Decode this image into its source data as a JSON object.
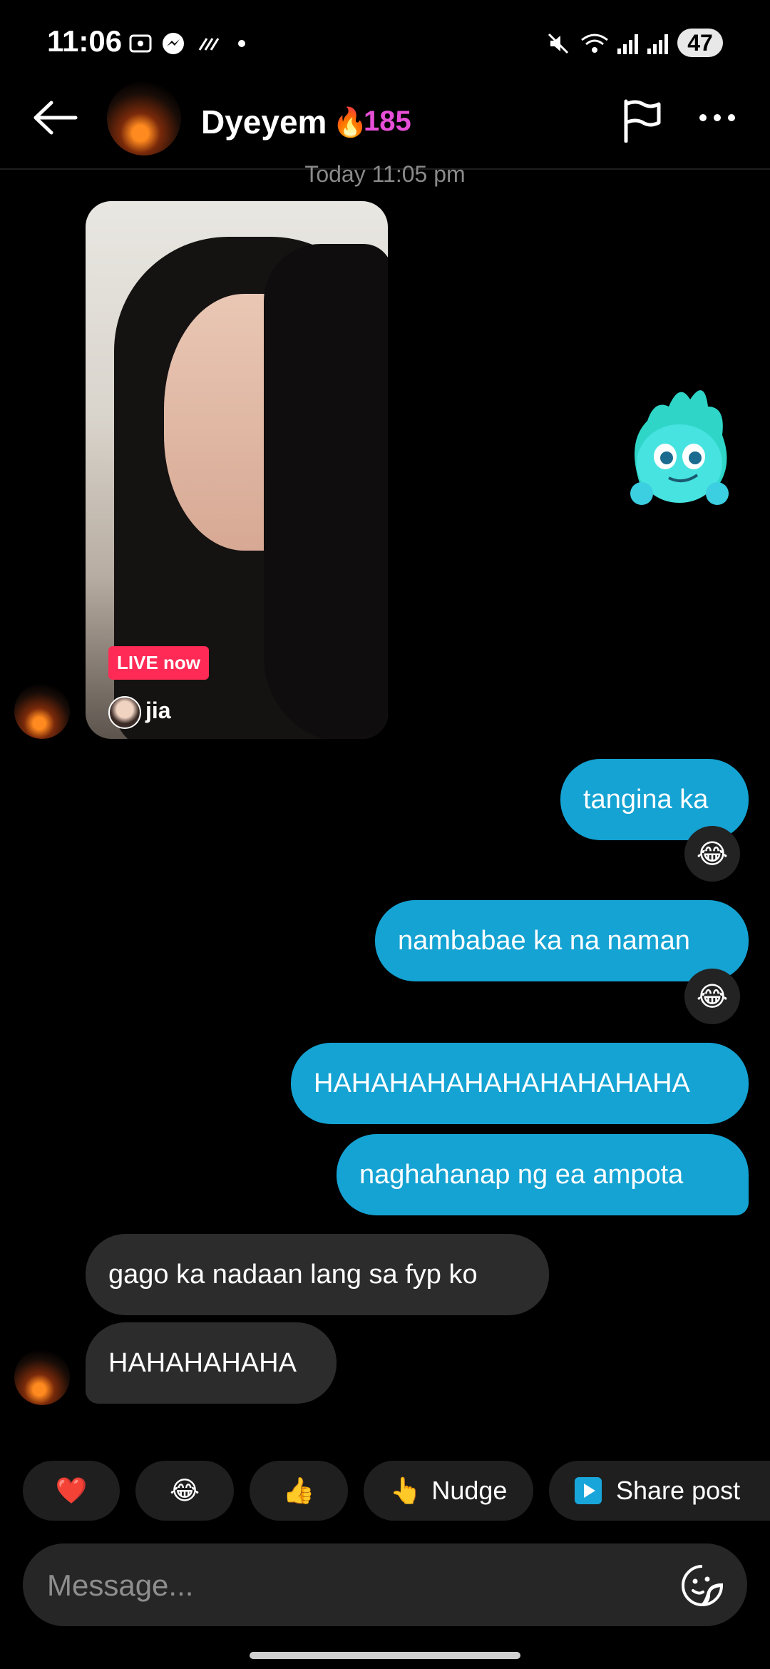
{
  "status_bar": {
    "time": "11:06",
    "battery": "47"
  },
  "header": {
    "name": "Dyeyem",
    "flame": "🔥",
    "streak": "185"
  },
  "chat": {
    "date_label": "Today 11:05 pm",
    "live_card": {
      "badge": "LIVE now",
      "username": "jia"
    },
    "messages": [
      {
        "text": "tangina ka",
        "direction": "outgoing",
        "reaction": "😂"
      },
      {
        "text": "nambabae ka na naman",
        "direction": "outgoing",
        "reaction": "😂"
      },
      {
        "text": "HAHAHAHAHAHAHAHAHAHA",
        "direction": "outgoing"
      },
      {
        "text": "naghahanap ng ea ampota",
        "direction": "outgoing"
      },
      {
        "text": "gago ka nadaan lang sa fyp ko",
        "direction": "incoming"
      },
      {
        "text": "HAHAHAHAHA",
        "direction": "incoming"
      }
    ]
  },
  "quick_replies": {
    "heart": "❤️",
    "laugh": "😂",
    "thumbs": "👍",
    "nudge_emoji": "👆",
    "nudge": "Nudge",
    "share_post": "Share post"
  },
  "composer": {
    "placeholder": "Message..."
  },
  "colors": {
    "outgoing_bubble": "#14a3d3",
    "incoming_bubble": "#2c2c2c",
    "live_badge": "#ff2a55",
    "streak": "#e84fd8"
  }
}
